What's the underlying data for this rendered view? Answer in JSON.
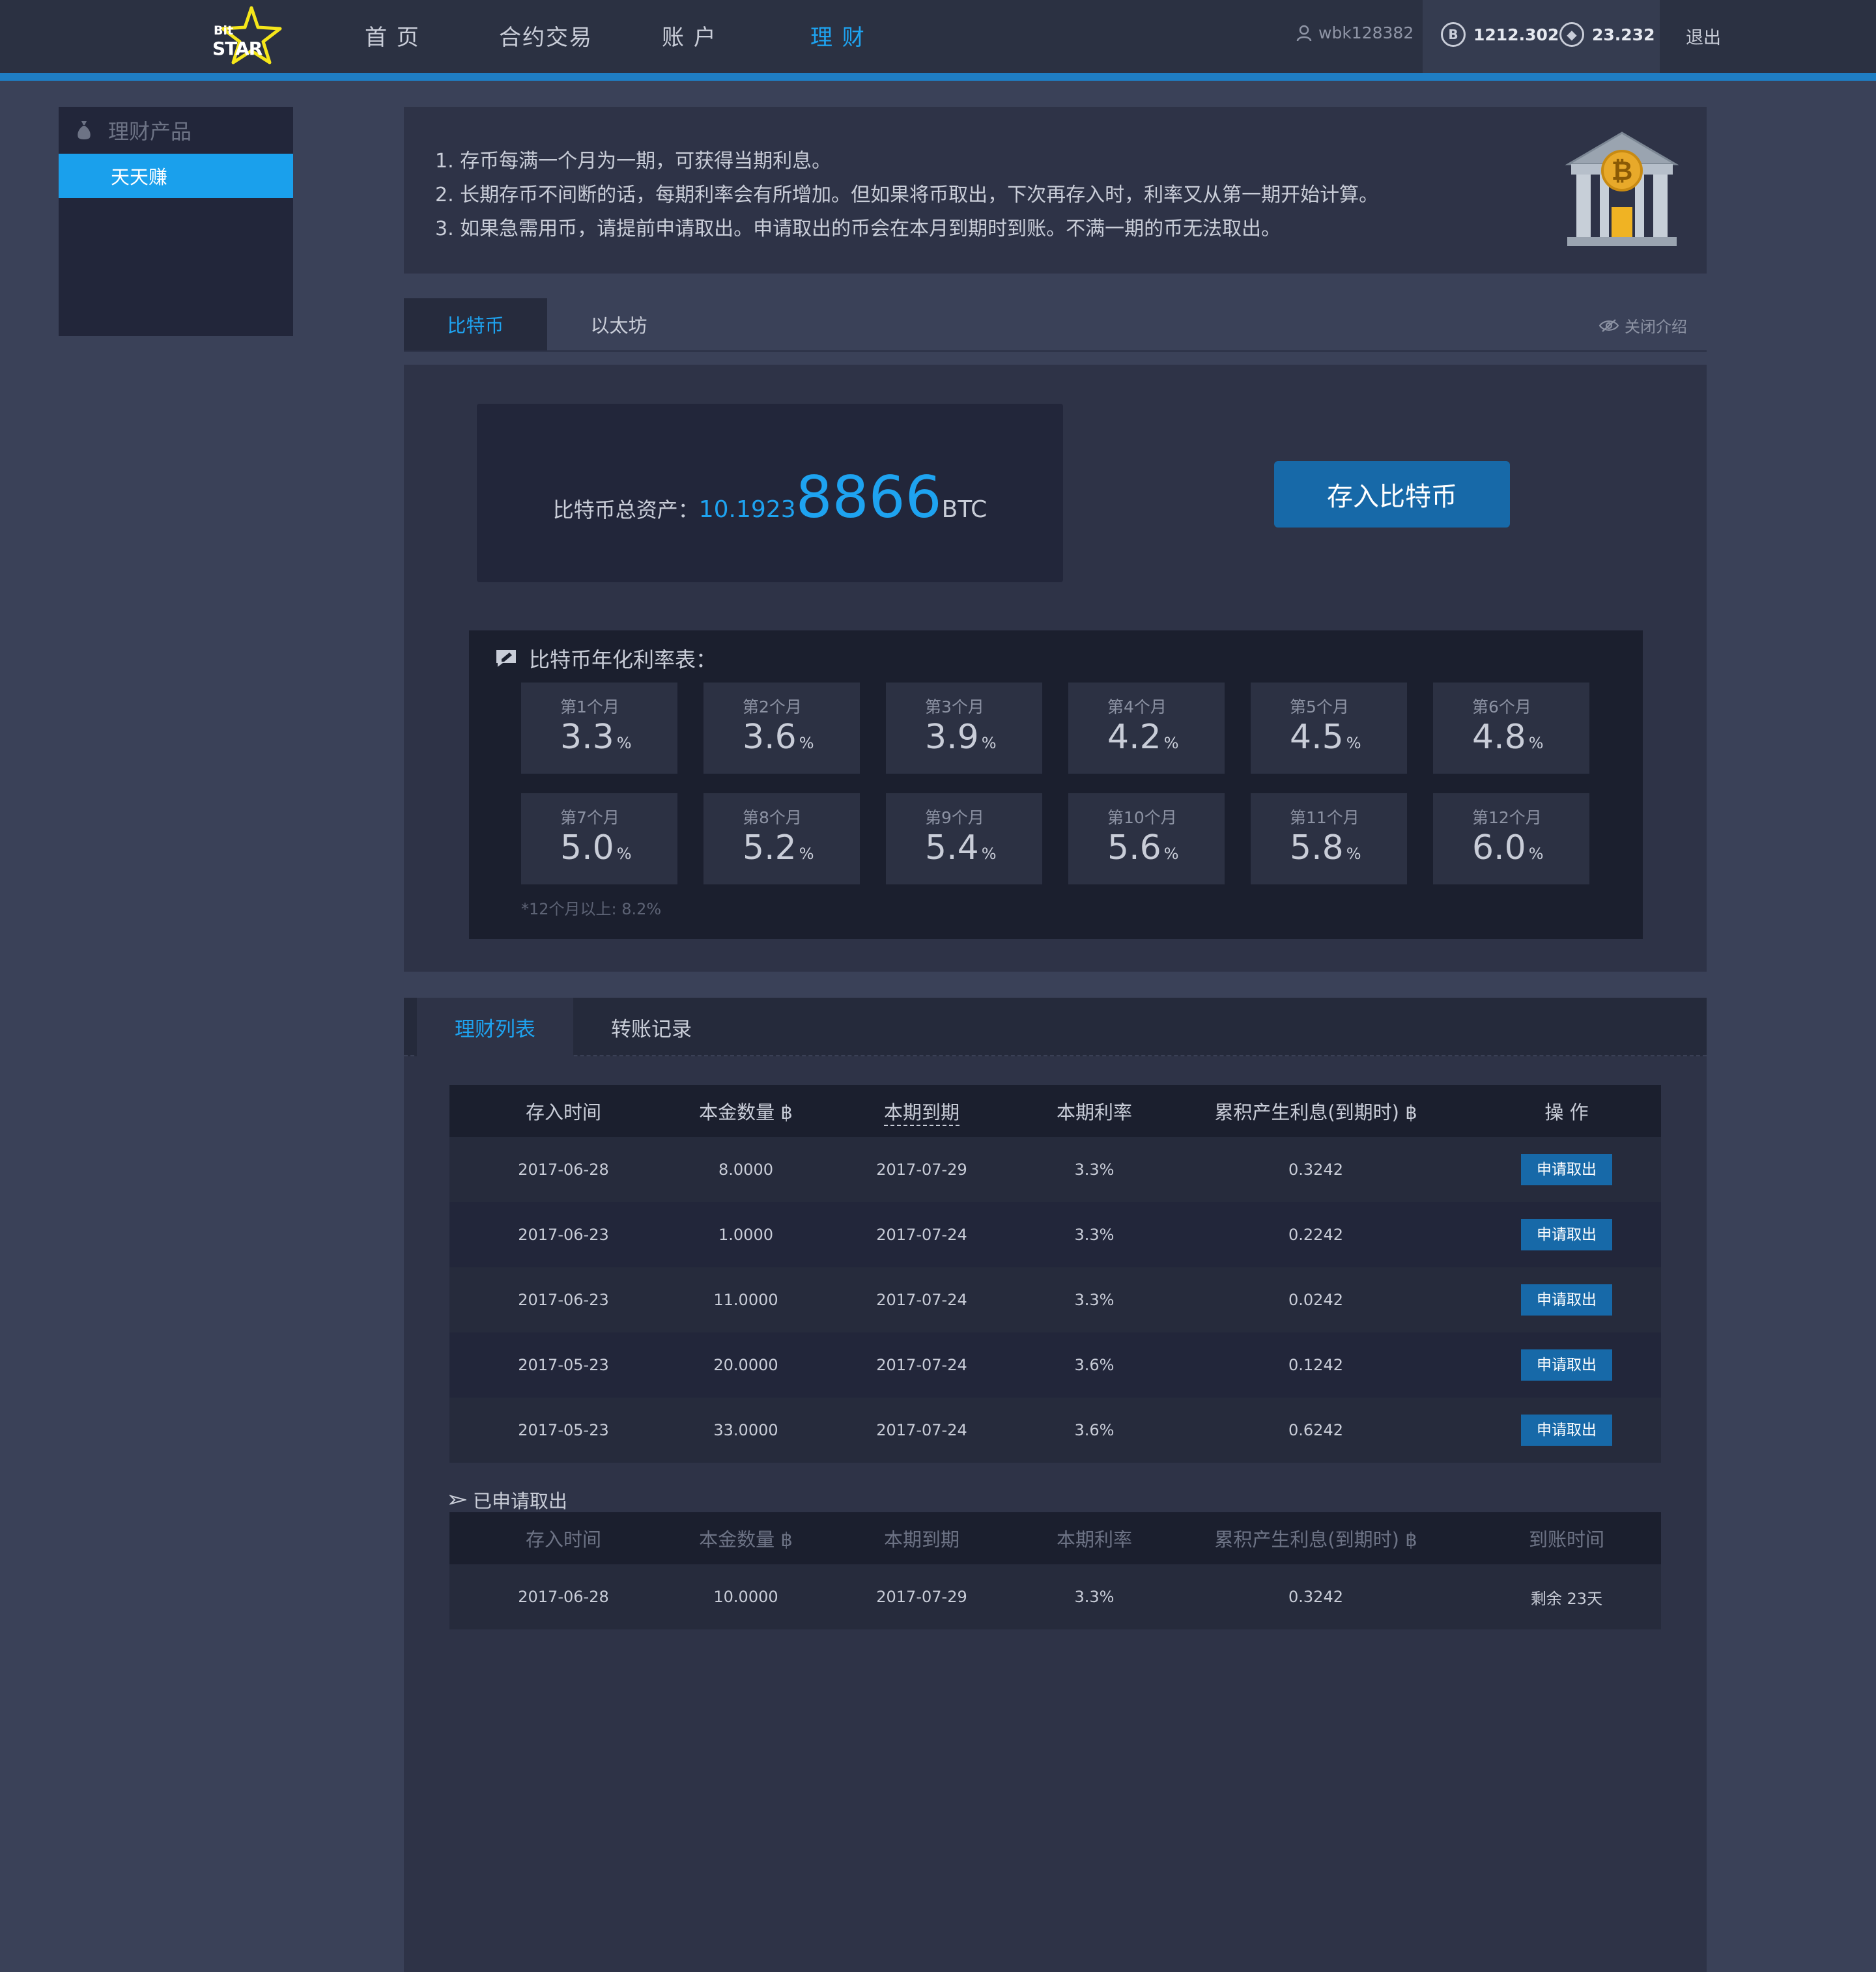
{
  "header": {
    "logo_top": "Bit",
    "logo_bottom": "STAR",
    "nav": [
      "首 页",
      "合约交易",
      "账 户",
      "理 财"
    ],
    "active_nav": "理 财",
    "username": "wbk128382",
    "btc_balance": "1212.302",
    "eth_balance": "23.232",
    "logout": "退出",
    "accent_color": "#1ea3f0"
  },
  "sidebar": {
    "title": "理财产品",
    "items": [
      "天天赚"
    ]
  },
  "notice": {
    "lines": [
      "1. 存币每满一个月为一期，可获得当期利息。",
      "2. 长期存币不间断的话，每期利率会有所增加。但如果将币取出，下次再存入时，利率又从第一期开始计算。",
      "3. 如果急需用币，请提前申请取出。申请取出的币会在本月到期时到账。不满一期的币无法取出。"
    ]
  },
  "currency_tabs": [
    "比特币",
    "以太坊"
  ],
  "close_intro": "关闭介绍",
  "asset": {
    "label": "比特币总资产：",
    "value_small": "10.1923",
    "value_big": "8866",
    "unit": "BTC",
    "deposit_button": "存入比特币"
  },
  "rates": {
    "title": "比特币年化利率表：",
    "pct_symbol": "%",
    "items": [
      {
        "month": "第1个月",
        "rate": "3.3"
      },
      {
        "month": "第2个月",
        "rate": "3.6"
      },
      {
        "month": "第3个月",
        "rate": "3.9"
      },
      {
        "month": "第4个月",
        "rate": "4.2"
      },
      {
        "month": "第5个月",
        "rate": "4.5"
      },
      {
        "month": "第6个月",
        "rate": "4.8"
      },
      {
        "month": "第7个月",
        "rate": "5.0"
      },
      {
        "month": "第8个月",
        "rate": "5.2"
      },
      {
        "month": "第9个月",
        "rate": "5.4"
      },
      {
        "month": "第10个月",
        "rate": "5.6"
      },
      {
        "month": "第11个月",
        "rate": "5.8"
      },
      {
        "month": "第12个月",
        "rate": "6.0"
      }
    ],
    "note": "*12个月以上: 8.2%"
  },
  "list_tabs": [
    "理财列表",
    "转账记录"
  ],
  "active_table": {
    "headers": [
      "存入时间",
      "本金数量 ฿",
      "本期到期",
      "本期利率",
      "累积产生利息(到期时) ฿",
      "操 作"
    ],
    "action_label": "申请取出",
    "rows": [
      [
        "2017-06-28",
        "8.0000",
        "2017-07-29",
        "3.3%",
        "0.3242"
      ],
      [
        "2017-06-23",
        "1.0000",
        "2017-07-24",
        "3.3%",
        "0.2242"
      ],
      [
        "2017-06-23",
        "11.0000",
        "2017-07-24",
        "3.3%",
        "0.0242"
      ],
      [
        "2017-05-23",
        "20.0000",
        "2017-07-24",
        "3.6%",
        "0.1242"
      ],
      [
        "2017-05-23",
        "33.0000",
        "2017-07-24",
        "3.6%",
        "0.6242"
      ]
    ]
  },
  "applied": {
    "title": "已申请取出",
    "headers": [
      "存入时间",
      "本金数量 ฿",
      "本期到期",
      "本期利率",
      "累积产生利息(到期时) ฿",
      "到账时间"
    ],
    "rows": [
      [
        "2017-06-28",
        "10.0000",
        "2017-07-29",
        "3.3%",
        "0.3242",
        "剩余 23天"
      ]
    ]
  }
}
